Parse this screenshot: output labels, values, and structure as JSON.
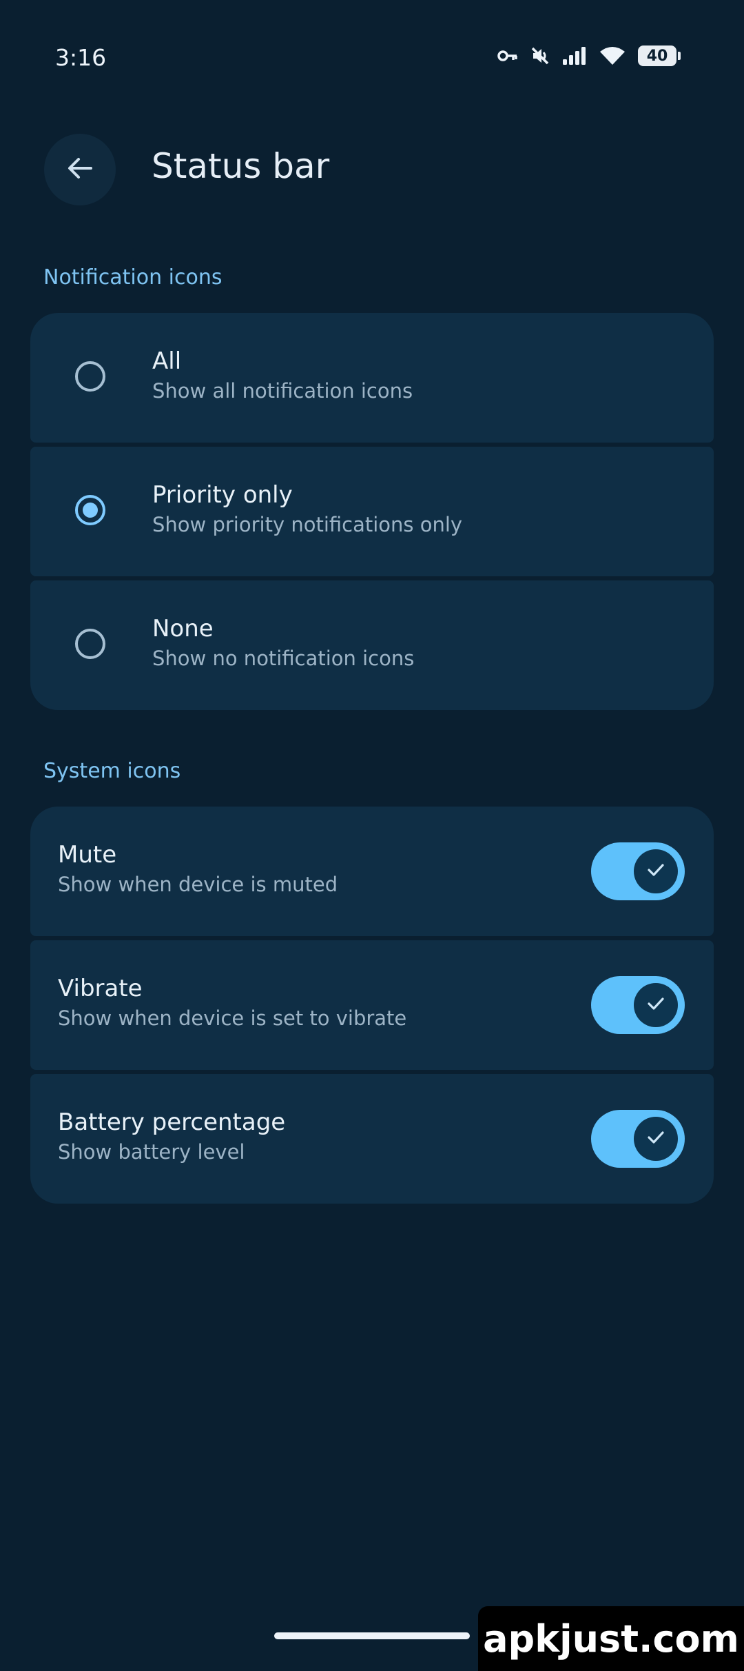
{
  "status_bar": {
    "time": "3:16",
    "battery_level": "40",
    "icons": [
      "vpn-key-icon",
      "mute-icon",
      "signal-icon",
      "wifi-icon",
      "battery-icon"
    ]
  },
  "header": {
    "title": "Status bar",
    "back_icon": "arrow-back-icon"
  },
  "notification_icons": {
    "label": "Notification icons",
    "options": [
      {
        "title": "All",
        "subtitle": "Show all notification icons",
        "selected": false
      },
      {
        "title": "Priority only",
        "subtitle": "Show priority notifications only",
        "selected": true
      },
      {
        "title": "None",
        "subtitle": "Show no notification icons",
        "selected": false
      }
    ]
  },
  "system_icons": {
    "label": "System icons",
    "items": [
      {
        "title": "Mute",
        "subtitle": "Show when device is muted",
        "enabled": true
      },
      {
        "title": "Vibrate",
        "subtitle": "Show when device is set to vibrate",
        "enabled": true
      },
      {
        "title": "Battery percentage",
        "subtitle": "Show battery level",
        "enabled": true
      }
    ]
  },
  "watermark": "apkjust.com",
  "colors": {
    "background": "#0a1f30",
    "card": "#0f2e45",
    "accent": "#7fcbff",
    "toggle_on": "#5ec1fb"
  }
}
